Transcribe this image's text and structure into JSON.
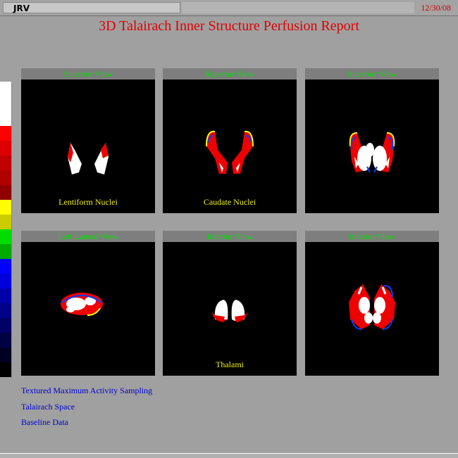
{
  "app": {
    "name": "JRV",
    "date": "12/30/08"
  },
  "report": {
    "title": "3D Talairach Inner Structure Perfusion Report"
  },
  "colorbar": {
    "colors": [
      "#ffffff",
      "#ffffff",
      "#ffffff",
      "#ff0000",
      "#dd0000",
      "#c00000",
      "#b00000",
      "#900000",
      "#ffff00",
      "#cccc00",
      "#00dd00",
      "#00aa00",
      "#0000ff",
      "#0000dd",
      "#0000aa",
      "#000088",
      "#000066",
      "#000044",
      "#000022",
      "#000000"
    ]
  },
  "panels": [
    {
      "caption": "Superior View",
      "label": "Lentiform Nuclei"
    },
    {
      "caption": "Superior View",
      "label": "Caudate Nuclei"
    },
    {
      "caption": "Superior View",
      "label": ""
    },
    {
      "caption": "Left Lateral View",
      "label": ""
    },
    {
      "caption": "Inferior View",
      "label": "Thalami"
    },
    {
      "caption": "Inferior View",
      "label": ""
    }
  ],
  "info_lines": [
    "Textured Maximum Activity Sampling",
    "Talairach Space",
    "Baseline Data"
  ]
}
